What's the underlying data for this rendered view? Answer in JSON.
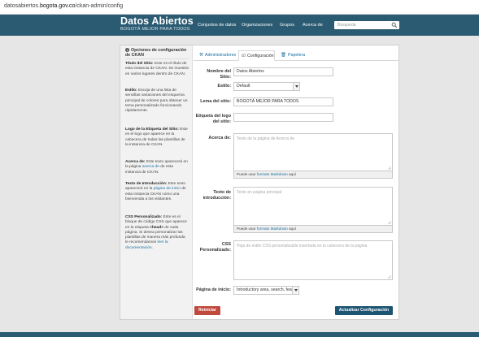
{
  "browser": {
    "url_prefix": "datosabiertos.",
    "url_domain": "bogota.gov.co",
    "url_path": "/ckan-admin/config"
  },
  "header": {
    "logo_title": "Datos Abiertos",
    "logo_subtitle": "BOGOTÁ MEJOR PARA TODOS",
    "nav": [
      "Conjuntos de datos",
      "Organizaciones",
      "Grupos",
      "Acerca de"
    ],
    "search_placeholder": "Búsqueda"
  },
  "sidebar": {
    "heading": "Opciones de configuración de CKAN",
    "items": [
      {
        "term": "Título del Sitio:",
        "text": " Este es el título de esta instancia de CKAN. Se muestra en varios lugares dentro de CKAN."
      },
      {
        "term": "Estilo:",
        "text": " Escoja de una lista de sencillas variaciones del esquema principal de colores para obtener un tema personalizado funcionando rápidamente."
      },
      {
        "term": "Logo de la Etiqueta del Sitio:",
        "text": " Este es el logo que aparece en la cabecera de todas las plantillas de la instancia de CKAN."
      },
      {
        "term": "Acerca de:",
        "text_a": " Este texto aparecerá en la página ",
        "link": "acerca de",
        "text_b": " de esta instancia de CKAN."
      },
      {
        "term": "Texto de Introducción:",
        "text_a": " Este texto aparecerá en la ",
        "link": "página de inicio",
        "text_b": " de esta instancia CKAN como una bienvenida a los visitantes."
      },
      {
        "term": "CSS Personalizado:",
        "text_a": " Este es el bloque de código CSS que aparece en la etiqueta ",
        "code": "<head>",
        "text_b": " de cada página. Si desea personalizar las plantillas de manera más profunda le recomendamos ",
        "link": "leer la documentación",
        "text_c": "."
      }
    ]
  },
  "tabs": [
    {
      "label": "Administradores",
      "icon": "gavel-icon"
    },
    {
      "label": "Configuración",
      "icon": "check-square-icon",
      "active": true
    },
    {
      "label": "Papelera",
      "icon": "trash-icon"
    }
  ],
  "form": {
    "site_title_label": "Nombre del Sitio:",
    "site_title_value": "Datos Abiertos",
    "style_label": "Estilo:",
    "style_value": "Default",
    "tagline_label": "Lema del sitio:",
    "tagline_value": "BOGOTÁ MEJOR PARA TODOS",
    "logo_label": "Etiqueta del logo del sitio:",
    "logo_value": "",
    "about_label": "Acerca de:",
    "about_placeholder": "Texto de la página de Acerca de",
    "intro_label": "Texto de introducción:",
    "intro_placeholder": "Texto en página principal",
    "css_label": "CSS Personalizado:",
    "css_placeholder": "Hoja de estilo CSS personalizable insertada en la cabecera de la página",
    "homepage_label": "Página de inicio:",
    "homepage_value": "Introductory area, search, feat",
    "markdown_prefix": "Puede usar ",
    "markdown_link": "formato Markdown",
    "markdown_suffix": " aquí"
  },
  "actions": {
    "reset_label": "Reiniciar",
    "update_label": "Actualizar Configuración"
  },
  "colors": {
    "brand": "#2a5b72",
    "danger": "#c14a3e",
    "primary": "#1d5473",
    "link": "#1a6fa0"
  }
}
